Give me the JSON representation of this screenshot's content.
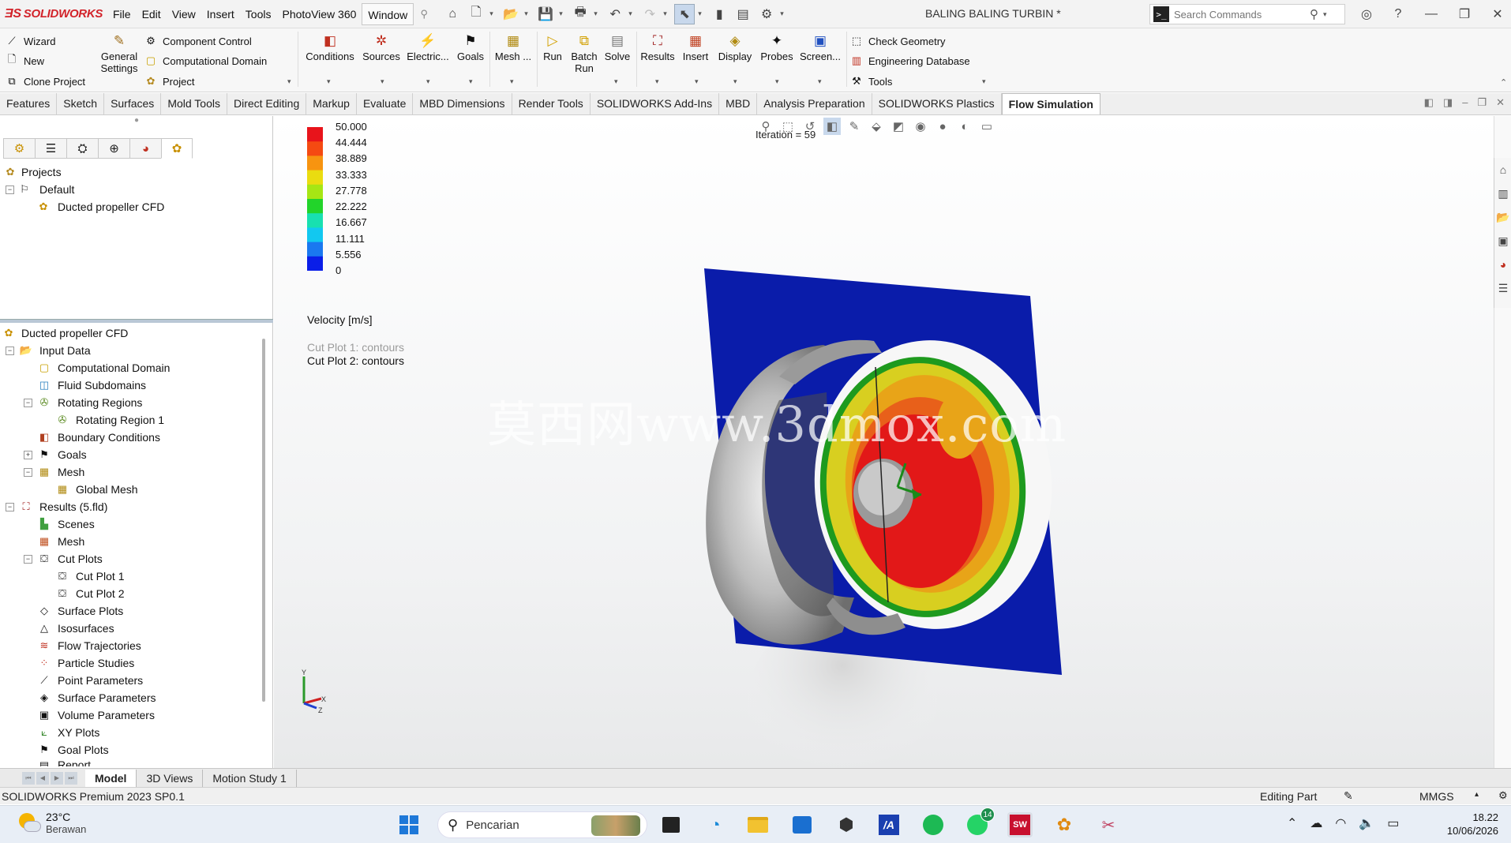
{
  "app": {
    "brand": "SOLIDWORKS",
    "menus": [
      "File",
      "Edit",
      "View",
      "Insert",
      "Tools",
      "PhotoView 360",
      "Window"
    ],
    "active_menu": "Window",
    "document_title": "BALING BALING TURBIN *",
    "search_placeholder": "Search Commands"
  },
  "command_manager": {
    "left_items": [
      "Wizard",
      "New",
      "Clone Project"
    ],
    "general_settings": "General Settings",
    "mid_items": [
      "Component Control",
      "Computational Domain",
      "Project"
    ],
    "big_buttons": {
      "conditions": "Conditions",
      "sources": "Sources",
      "electric": "Electric...",
      "goals": "Goals",
      "mesh": "Mesh ...",
      "run": "Run",
      "batch_run": "Batch Run",
      "solve": "Solve",
      "results": "Results",
      "insert": "Insert",
      "display": "Display",
      "probes": "Probes",
      "screen": "Screen..."
    },
    "right_items": [
      "Check Geometry",
      "Engineering Database",
      "Tools"
    ]
  },
  "tabs": [
    "Features",
    "Sketch",
    "Surfaces",
    "Mold Tools",
    "Direct Editing",
    "Markup",
    "Evaluate",
    "MBD Dimensions",
    "Render Tools",
    "SOLIDWORKS Add-Ins",
    "MBD",
    "Analysis Preparation",
    "SOLIDWORKS Plastics",
    "Flow Simulation"
  ],
  "active_tab": "Flow Simulation",
  "projects_tree": {
    "root": "Projects",
    "default": "Default",
    "project": "Ducted propeller CFD"
  },
  "analysis_tree": {
    "root": "Ducted propeller CFD",
    "input_data": "Input Data",
    "computational_domain": "Computational Domain",
    "fluid_subdomains": "Fluid Subdomains",
    "rotating_regions": "Rotating Regions",
    "rotating_region_1": "Rotating Region 1",
    "boundary_conditions": "Boundary Conditions",
    "goals": "Goals",
    "mesh": "Mesh",
    "global_mesh": "Global Mesh",
    "results": "Results (5.fld)",
    "scenes": "Scenes",
    "results_mesh": "Mesh",
    "cut_plots": "Cut Plots",
    "cut_plot_1": "Cut Plot 1",
    "cut_plot_2": "Cut Plot 2",
    "surface_plots": "Surface Plots",
    "isosurfaces": "Isosurfaces",
    "flow_trajectories": "Flow Trajectories",
    "particle_studies": "Particle Studies",
    "point_parameters": "Point Parameters",
    "surface_parameters": "Surface Parameters",
    "volume_parameters": "Volume Parameters",
    "xy_plots": "XY Plots",
    "goal_plots": "Goal Plots",
    "report": "Report"
  },
  "viewport": {
    "iteration": "Iteration = 59",
    "legend_values": [
      "50.000",
      "44.444",
      "38.889",
      "33.333",
      "27.778",
      "22.222",
      "16.667",
      "11.111",
      "5.556",
      "0"
    ],
    "legend_colors": [
      "#e8141b",
      "#f54a12",
      "#f79410",
      "#eadc10",
      "#a6e614",
      "#22d42a",
      "#18e0b0",
      "#12c8f0",
      "#1a78f0",
      "#0a1ee8"
    ],
    "legend_title": "Velocity [m/s]",
    "cut_plot_1_label": "Cut Plot 1: contours",
    "cut_plot_2_label": "Cut Plot 2: contours",
    "watermark": "莫西网www.3dmox.com"
  },
  "bottom_tabs": [
    "Model",
    "3D Views",
    "Motion Study 1"
  ],
  "active_bottom_tab": "Model",
  "status": {
    "version": "SOLIDWORKS Premium 2023 SP0.1",
    "mode": "Editing Part",
    "units": "MMGS"
  },
  "taskbar": {
    "temperature": "23°C",
    "weather": "Berawan",
    "search": "Pencarian",
    "whatsapp_badge": "14",
    "time": "18.22",
    "date": "10/06/2026"
  }
}
